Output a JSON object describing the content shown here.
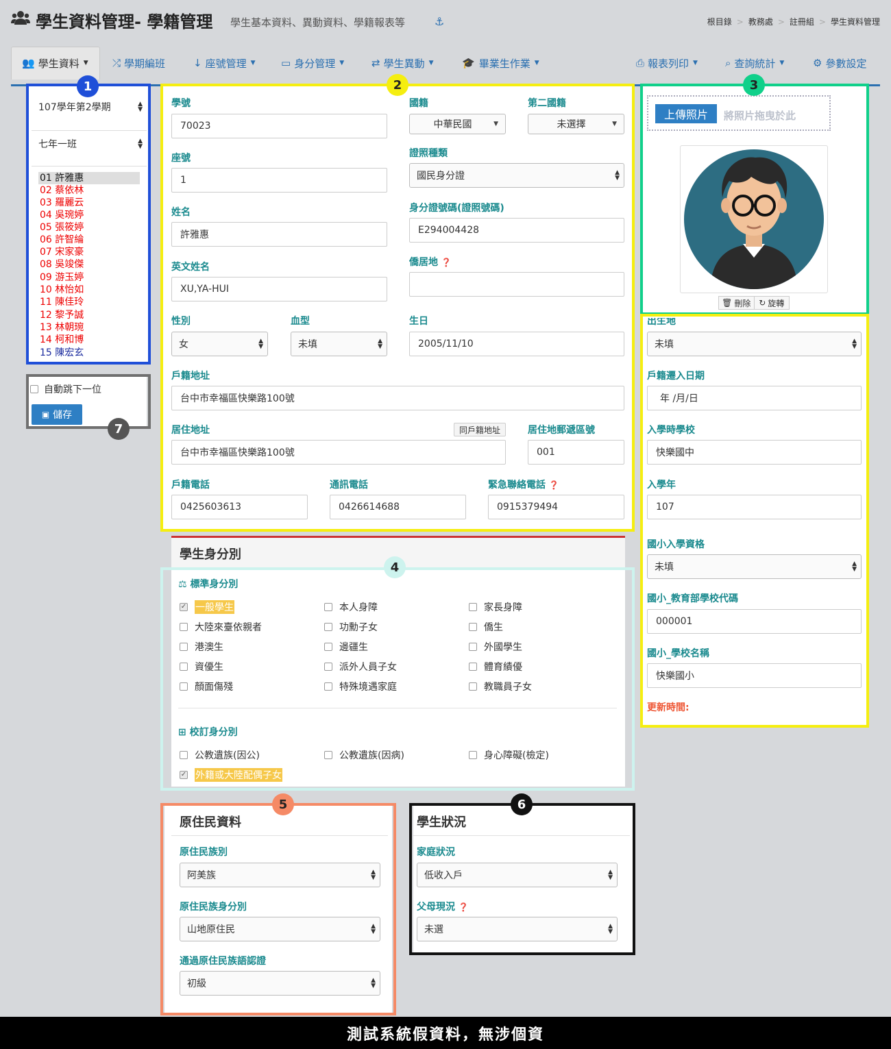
{
  "header": {
    "title": "學生資料管理- 學籍管理",
    "subtitle": "學生基本資料、異動資料、學籍報表等",
    "breadcrumb": [
      "根目錄",
      "教務處",
      "註冊組",
      "學生資料管理"
    ]
  },
  "nav": {
    "items": [
      "學生資料",
      "學期編班",
      "座號管理",
      "身分管理",
      "學生異動",
      "畢業生作業"
    ],
    "right": [
      "報表列印",
      "查詢統計",
      "參數設定"
    ]
  },
  "sidebar": {
    "term": "107學年第2學期",
    "class": "七年一班",
    "students": [
      {
        "no": "01",
        "name": "許雅惠"
      },
      {
        "no": "02",
        "name": "蔡依林"
      },
      {
        "no": "03",
        "name": "羅麗云"
      },
      {
        "no": "04",
        "name": "吳琬婷"
      },
      {
        "no": "05",
        "name": "張筱婷"
      },
      {
        "no": "06",
        "name": "許智綸"
      },
      {
        "no": "07",
        "name": "宋家豪"
      },
      {
        "no": "08",
        "name": "吳竣傑"
      },
      {
        "no": "09",
        "name": "游玉婷"
      },
      {
        "no": "10",
        "name": "林怡如"
      },
      {
        "no": "11",
        "name": "陳佳玲"
      },
      {
        "no": "12",
        "name": "黎予誠"
      },
      {
        "no": "13",
        "name": "林朝琬"
      },
      {
        "no": "14",
        "name": "柯和博"
      },
      {
        "no": "15",
        "name": "陳宏玄"
      }
    ],
    "auto_next": "自動跳下一位",
    "save": "儲存"
  },
  "basic": {
    "student_id_label": "學號",
    "student_id": "70023",
    "seat_label": "座號",
    "seat": "1",
    "name_label": "姓名",
    "name": "許雅惠",
    "en_name_label": "英文姓名",
    "en_name": "XU,YA-HUI",
    "nationality_label": "國籍",
    "nationality": "中華民國",
    "nationality2_label": "第二國籍",
    "nationality2": "未選擇",
    "id_type_label": "證照種類",
    "id_type": "國民身分證",
    "id_no_label": "身分證號碼(證照號碼)",
    "id_no": "E294004428",
    "overseas_label": "僑居地",
    "overseas": "",
    "gender_label": "性別",
    "gender": "女",
    "blood_label": "血型",
    "blood": "未填",
    "birthday_label": "生日",
    "birthday": "2005/11/10",
    "reg_addr_label": "戶籍地址",
    "reg_addr": "台中市幸福區快樂路100號",
    "live_addr_label": "居住地址",
    "same_btn": "同戶籍地址",
    "live_addr": "台中市幸福區快樂路100號",
    "zip_label": "居住地郵遞區號",
    "zip": "001",
    "reg_phone_label": "戶籍電話",
    "reg_phone": "0425603613",
    "phone_label": "通訊電話",
    "phone": "0426614688",
    "emergency_label": "緊急聯絡電話",
    "emergency": "0915379494"
  },
  "photo": {
    "upload": "上傳照片",
    "drop_hint": "將照片拖曳於此",
    "delete": "刪除",
    "rotate": "旋轉"
  },
  "side": {
    "birthplace_label": "出生地",
    "birthplace": "未填",
    "move_in_label": "戶籍遷入日期",
    "move_in": "年 /月/日",
    "school_label": "入學時學校",
    "school": "快樂國中",
    "year_label": "入學年",
    "year": "107",
    "elem_qual_label": "國小入學資格",
    "elem_qual": "未填",
    "elem_code_label": "國小_教育部學校代碼",
    "elem_code": "000001",
    "elem_name_label": "國小_學校名稱",
    "elem_name": "快樂國小",
    "updated_label": "更新時間:"
  },
  "identity": {
    "title": "學生身分別",
    "std_title": "標準身分別",
    "std": [
      [
        "一般學生",
        "本人身障",
        "家長身障"
      ],
      [
        "大陸來臺依親者",
        "功勳子女",
        "僑生"
      ],
      [
        "港澳生",
        "邊疆生",
        "外國學生"
      ],
      [
        "資優生",
        "派外人員子女",
        "體育績優"
      ],
      [
        "顏面傷殘",
        "特殊境遇家庭",
        "教職員子女"
      ]
    ],
    "rev_title": "校訂身分別",
    "rev": [
      [
        "公教遺族(因公)",
        "公教遺族(因病)",
        "身心障礙(檢定)"
      ],
      [
        "外籍或大陸配偶子女"
      ]
    ]
  },
  "aboriginal": {
    "title": "原住民資料",
    "tribe_label": "原住民族別",
    "tribe": "阿美族",
    "type_label": "原住民族身分別",
    "type": "山地原住民",
    "lang_label": "通過原住民族語認證",
    "lang": "初級"
  },
  "status": {
    "title": "學生狀況",
    "family_label": "家庭狀況",
    "family": "低收入戶",
    "parents_label": "父母現況",
    "parents": "未選"
  },
  "badges": [
    "1",
    "2",
    "3",
    "4",
    "5",
    "6",
    "7"
  ],
  "footer": "測試系統假資料，無涉個資",
  "colors": {
    "blue": "#1f4fd8",
    "yellow": "#f5ee10",
    "green": "#10d08a",
    "cyan": "#cdf3ee",
    "orange": "#f58a66",
    "black": "#111111",
    "gray": "#707070"
  }
}
